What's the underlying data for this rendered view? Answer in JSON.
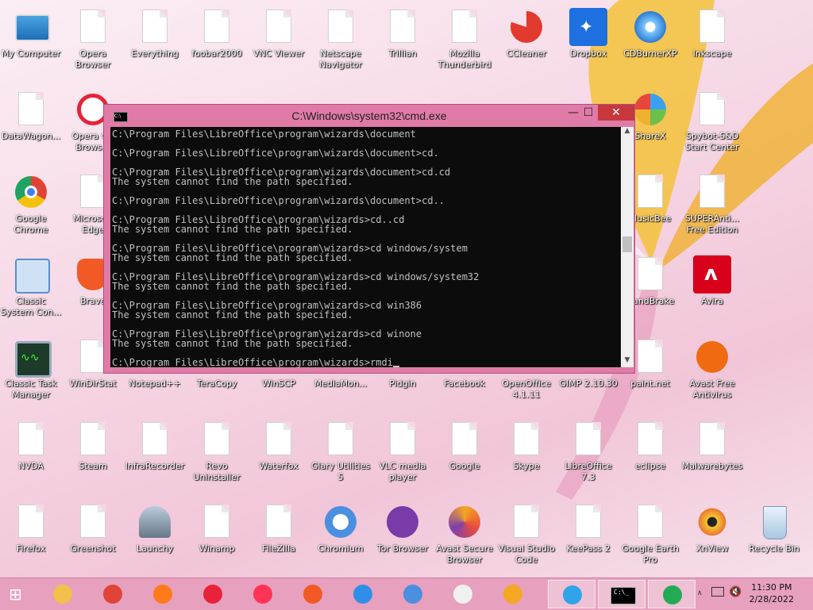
{
  "desktop": {
    "icons": [
      {
        "label": "My Computer",
        "icon": "computer-icon"
      },
      {
        "label": "Opera\nBrowser",
        "icon": "file-icon"
      },
      {
        "label": "Everything",
        "icon": "file-icon"
      },
      {
        "label": "foobar2000",
        "icon": "file-icon"
      },
      {
        "label": "VNC Viewer",
        "icon": "file-icon"
      },
      {
        "label": "Netscape\nNavigator",
        "icon": "file-icon"
      },
      {
        "label": "Trillian",
        "icon": "file-icon"
      },
      {
        "label": "Mozilla\nThunderbird",
        "icon": "file-icon"
      },
      {
        "label": "CCleaner",
        "icon": "ccleaner-icon"
      },
      {
        "label": "Dropbox",
        "icon": "dropbox-icon"
      },
      {
        "label": "CDBurnerXP",
        "icon": "cdburner-icon"
      },
      {
        "label": "Inkscape",
        "icon": "file-icon"
      },
      {
        "label": "DataWagon...",
        "icon": "file-icon"
      },
      {
        "label": "Opera GX\nBrows...",
        "icon": "opera-gx-icon"
      },
      {
        "label": "ShareX",
        "icon": "sharex-icon"
      },
      {
        "label": "Spybot-S&D\nStart Center",
        "icon": "file-icon"
      },
      {
        "label": "Google\nChrome",
        "icon": "chrome-icon"
      },
      {
        "label": "Microsoft\nEdge",
        "icon": "file-icon"
      },
      {
        "label": "MusicBee",
        "icon": "file-icon"
      },
      {
        "label": "SUPERAnti...\nFree Edition",
        "icon": "file-icon"
      },
      {
        "label": "Classic\nSystem Con...",
        "icon": "control-panel-icon"
      },
      {
        "label": "Brave",
        "icon": "brave-icon"
      },
      {
        "label": "HandBrake",
        "icon": "file-icon"
      },
      {
        "label": "Avira",
        "icon": "avira-icon"
      },
      {
        "label": "Classic Task\nManager",
        "icon": "task-manager-icon"
      },
      {
        "label": "WinDirStat",
        "icon": "file-icon"
      },
      {
        "label": "Notepad++",
        "icon": "file-icon"
      },
      {
        "label": "TeraCopy",
        "icon": "file-icon"
      },
      {
        "label": "WinSCP",
        "icon": "file-icon"
      },
      {
        "label": "MediaMon...",
        "icon": "file-icon"
      },
      {
        "label": "Pidgin",
        "icon": "file-icon"
      },
      {
        "label": "Facebook",
        "icon": "file-icon"
      },
      {
        "label": "OpenOffice\n4.1.11",
        "icon": "file-icon"
      },
      {
        "label": "GIMP 2.10.30",
        "icon": "file-icon"
      },
      {
        "label": "paint.net",
        "icon": "file-icon"
      },
      {
        "label": "Avast Free\nAntivirus",
        "icon": "avast-icon"
      },
      {
        "label": "NVDA",
        "icon": "file-icon"
      },
      {
        "label": "Steam",
        "icon": "file-icon"
      },
      {
        "label": "InfraRecorder",
        "icon": "file-icon"
      },
      {
        "label": "Revo\nUninstaller",
        "icon": "file-icon"
      },
      {
        "label": "Waterfox",
        "icon": "file-icon"
      },
      {
        "label": "Glary Utilities\n5",
        "icon": "file-icon"
      },
      {
        "label": "VLC media\nplayer",
        "icon": "file-icon"
      },
      {
        "label": "Google",
        "icon": "file-icon"
      },
      {
        "label": "Skype",
        "icon": "file-icon"
      },
      {
        "label": "LibreOffice\n7.3",
        "icon": "file-icon"
      },
      {
        "label": "eclipse",
        "icon": "file-icon"
      },
      {
        "label": "Malwarebytes",
        "icon": "file-icon"
      },
      {
        "label": "Firefox",
        "icon": "file-icon"
      },
      {
        "label": "Greenshot",
        "icon": "file-icon"
      },
      {
        "label": "Launchy",
        "icon": "launchy-icon"
      },
      {
        "label": "Winamp",
        "icon": "file-icon"
      },
      {
        "label": "FileZilla",
        "icon": "file-icon"
      },
      {
        "label": "Chromium",
        "icon": "chromium-icon"
      },
      {
        "label": "Tor Browser",
        "icon": "tor-icon"
      },
      {
        "label": "Avast Secure\nBrowser",
        "icon": "avast-browser-icon"
      },
      {
        "label": "Visual Studio\nCode",
        "icon": "file-icon"
      },
      {
        "label": "KeePass 2",
        "icon": "file-icon"
      },
      {
        "label": "Google Earth\nPro",
        "icon": "file-icon"
      },
      {
        "label": "XnView",
        "icon": "xnview-icon"
      },
      {
        "label": "Recycle Bin",
        "icon": "recycle-bin-icon"
      }
    ]
  },
  "cmd_window": {
    "title": "C:\\Windows\\system32\\cmd.exe",
    "minimize": "—",
    "maximize": "☐",
    "close": "✕",
    "lines": [
      "C:\\Program Files\\LibreOffice\\program\\wizards\\document",
      "",
      "C:\\Program Files\\LibreOffice\\program\\wizards\\document>cd.",
      "",
      "C:\\Program Files\\LibreOffice\\program\\wizards\\document>cd.cd",
      "The system cannot find the path specified.",
      "",
      "C:\\Program Files\\LibreOffice\\program\\wizards\\document>cd..",
      "",
      "C:\\Program Files\\LibreOffice\\program\\wizards>cd..cd",
      "The system cannot find the path specified.",
      "",
      "C:\\Program Files\\LibreOffice\\program\\wizards>cd windows/system",
      "The system cannot find the path specified.",
      "",
      "C:\\Program Files\\LibreOffice\\program\\wizards>cd windows/system32",
      "The system cannot find the path specified.",
      "",
      "C:\\Program Files\\LibreOffice\\program\\wizards>cd win386",
      "The system cannot find the path specified.",
      "",
      "C:\\Program Files\\LibreOffice\\program\\wizards>cd winone",
      "The system cannot find the path specified.",
      ""
    ],
    "prompt": "C:\\Program Files\\LibreOffice\\program\\wizards>rmdi"
  },
  "taskbar": {
    "items": [
      "start-icon",
      "file-explorer-icon",
      "chrome-icon",
      "firefox-icon",
      "opera-icon",
      "opera-gx-icon",
      "brave-icon",
      "waterfox-icon",
      "chromium-icon",
      "avast-browser-icon",
      "avast-secure-icon",
      "skype-icon",
      "cmd-icon",
      "task-manager-icon"
    ],
    "time": "11:30 PM",
    "date": "2/28/2022"
  }
}
